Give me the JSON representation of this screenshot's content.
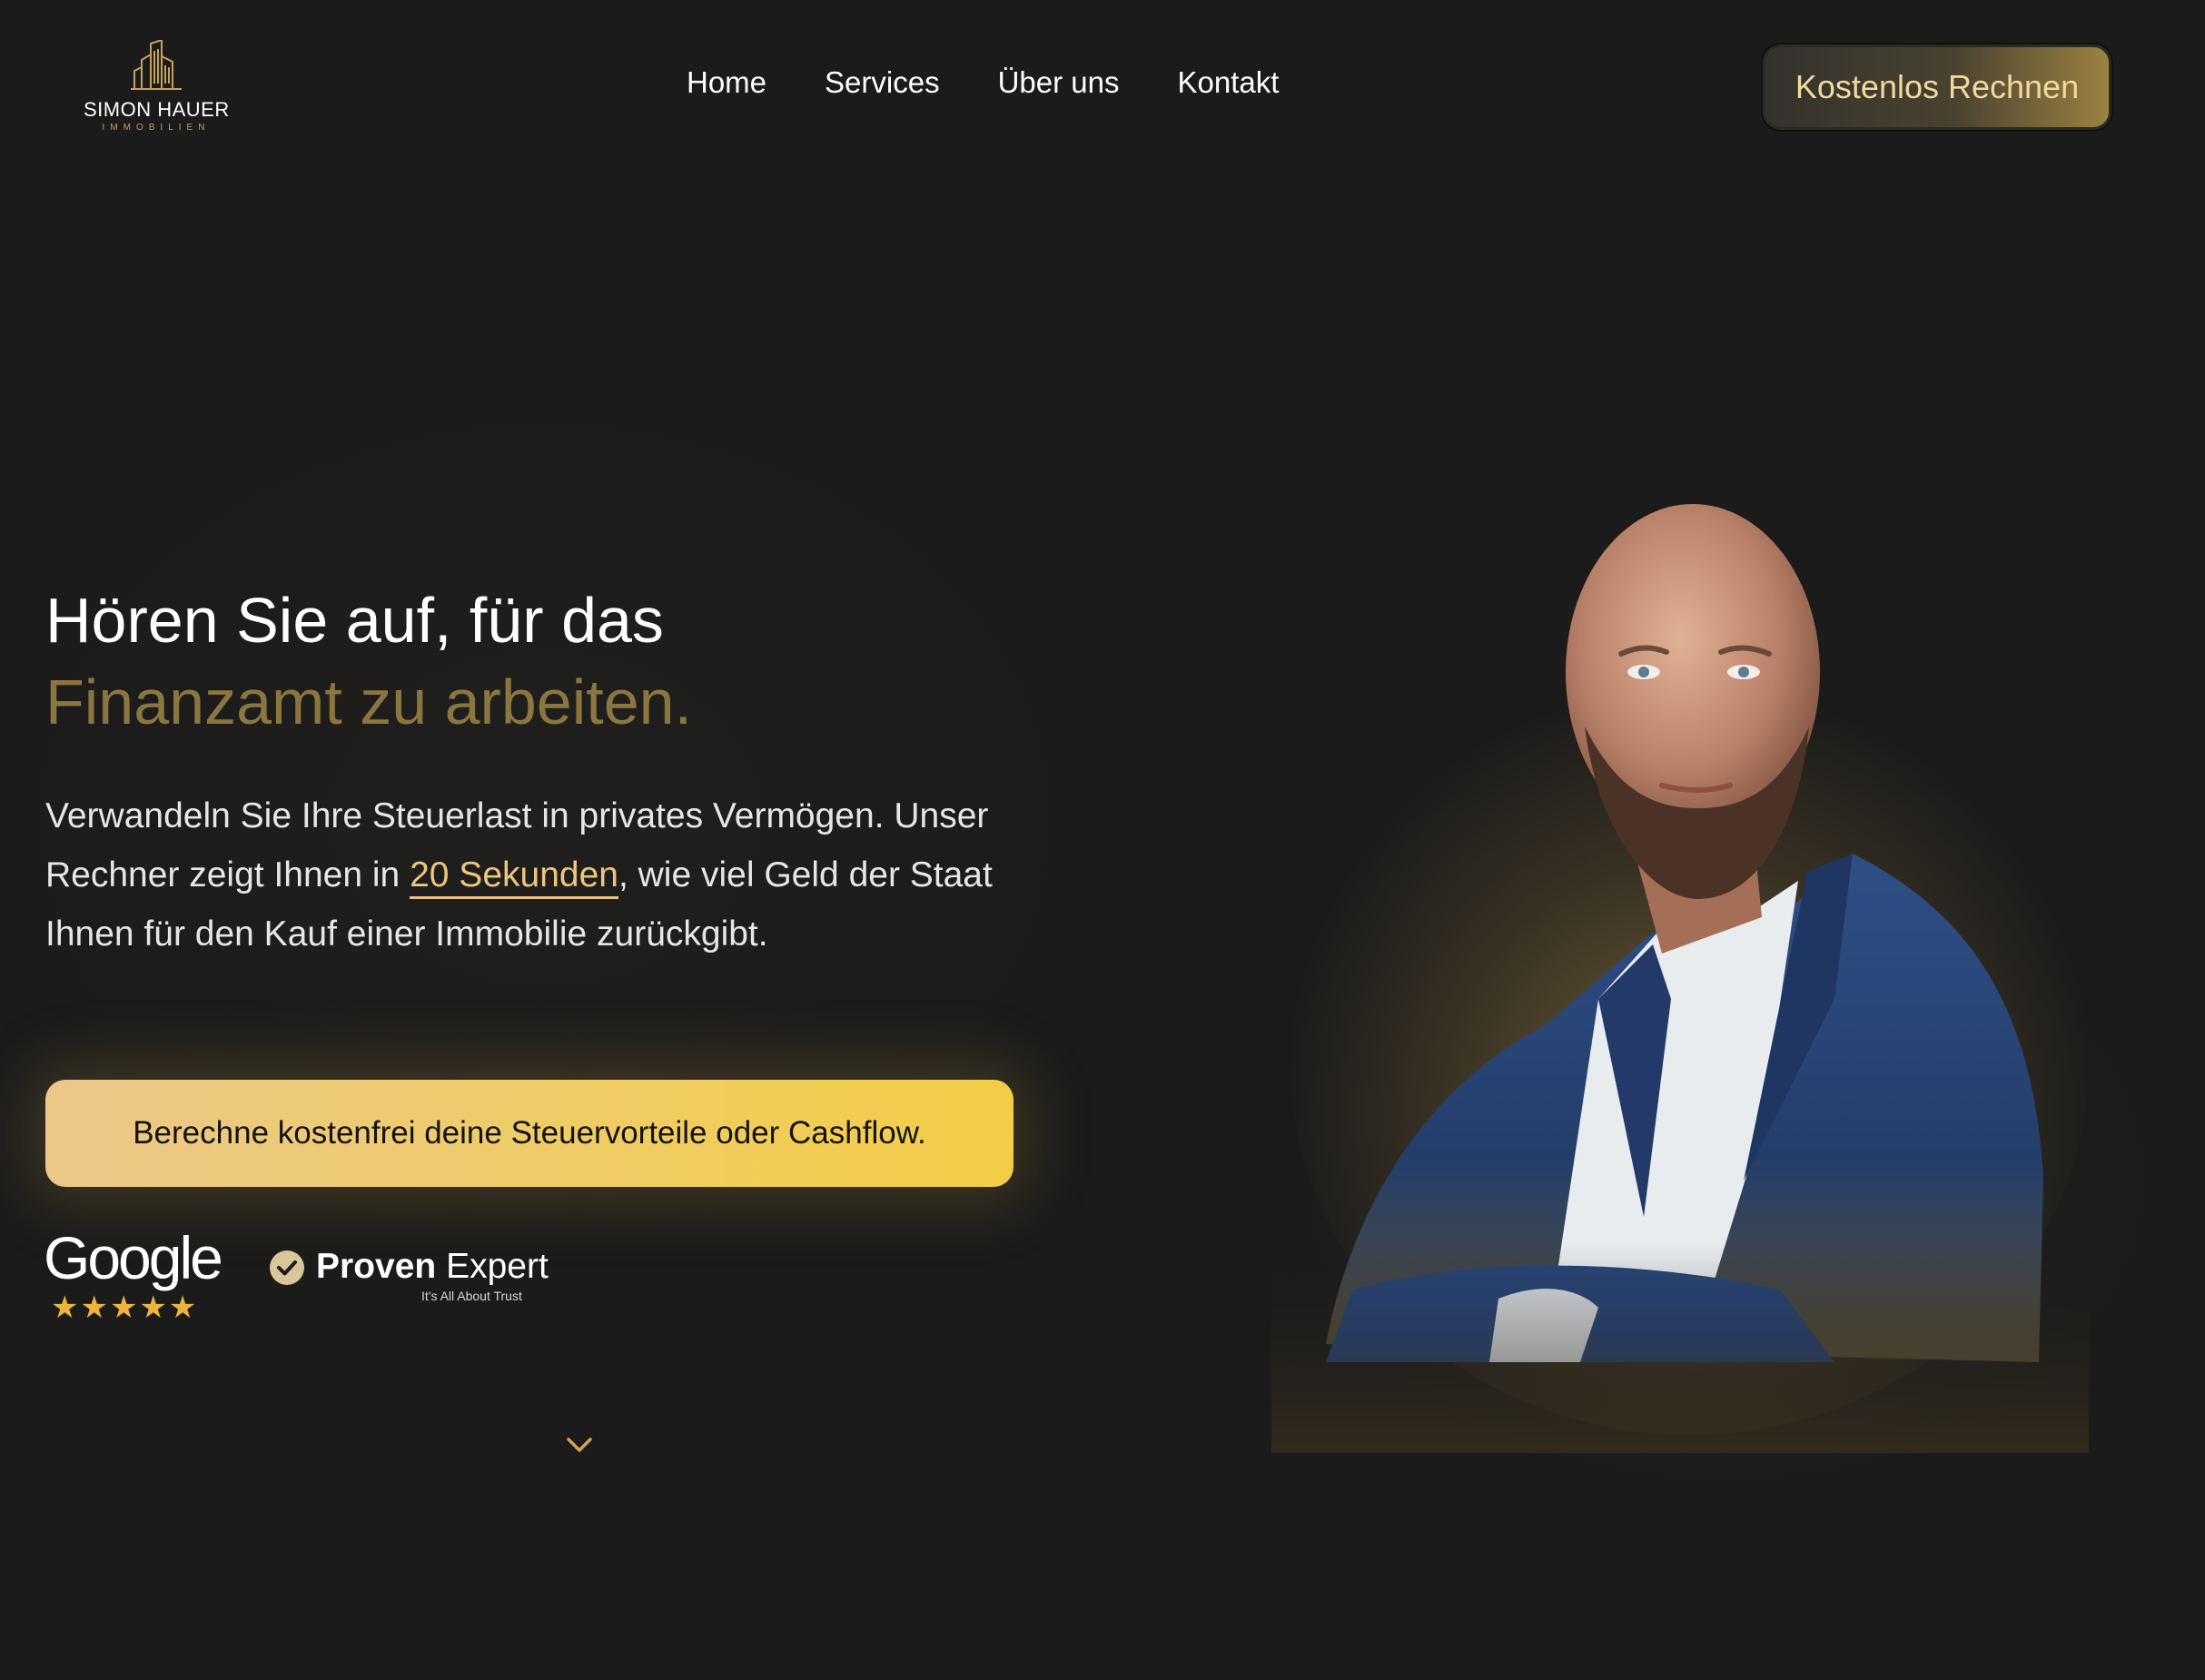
{
  "brand": {
    "name": "SIMON HAUER",
    "sub": "IMMOBILIEN",
    "accent": "#c6a15a"
  },
  "nav": {
    "items": [
      {
        "label": "Home"
      },
      {
        "label": "Services"
      },
      {
        "label": "Über uns"
      },
      {
        "label": "Kontakt"
      }
    ]
  },
  "header_cta": {
    "label": "Kostenlos Rechnen"
  },
  "hero": {
    "headline_line1": "Hören Sie auf, für das",
    "headline_line2": "Finanzamt zu arbeiten.",
    "lead_part1": "Verwandeln Sie Ihre Steuerlast in privates Vermögen. Unser Rechner zeigt Ihnen in ",
    "lead_highlight": "20 Sekunden",
    "lead_part2": ", wie viel Geld der Staat Ihnen für den Kauf einer Immobilie zurückgibt.",
    "cta_label": "Berechne kostenfrei deine Steuervorteile oder Cashflow."
  },
  "trust": {
    "google_label": "Google",
    "google_stars": "★★★★★",
    "google_rating": 5,
    "proven_bold": "Proven",
    "proven_light": "Expert",
    "proven_tagline": "It's All About Trust"
  },
  "icons": {
    "scroll": "chevron-down-icon",
    "logo": "building-icon",
    "proven": "check-circle-icon"
  },
  "colors": {
    "background": "#1b1b1b",
    "gold": "#ecc57e",
    "headline_gold": "#8c7640",
    "cta_start": "#ebc889",
    "cta_end": "#f3cd46",
    "star": "#eeb33a"
  }
}
